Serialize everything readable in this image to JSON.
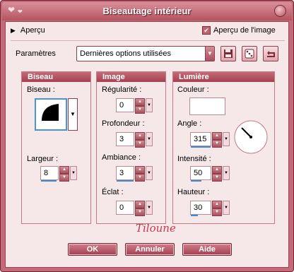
{
  "window": {
    "title": "Biseautage intérieur"
  },
  "preview": {
    "label": "Aperçu",
    "show_image_label": "Aperçu de l'image",
    "show_image_checked": true
  },
  "presets": {
    "label": "Paramètres",
    "value": "Dernières options utilisées"
  },
  "bevel": {
    "heading": "Biseau",
    "bevel_label": "Biseau :",
    "width_label": "Largeur :",
    "width_value": "8"
  },
  "image": {
    "heading": "Image",
    "smoothness_label": "Régularité :",
    "smoothness_value": "0",
    "depth_label": "Profondeur :",
    "depth_value": "3",
    "ambience_label": "Ambiance :",
    "ambience_value": "3",
    "shininess_label": "Éclat :",
    "shininess_value": "0"
  },
  "light": {
    "heading": "Lumière",
    "color_label": "Couleur :",
    "color": "#ffffff",
    "angle_label": "Angle :",
    "angle_value": "315",
    "intensity_label": "Intensité :",
    "intensity_value": "50",
    "elevation_label": "Hauteur :",
    "elevation_value": "30"
  },
  "signature": "Tiloune",
  "buttons": {
    "ok": "OK",
    "cancel": "Annuler",
    "help": "Aide"
  },
  "colors": {
    "accent": "#c56a78",
    "panel": "#f6e7e9",
    "spinner_bar": "#3c8ad8"
  }
}
